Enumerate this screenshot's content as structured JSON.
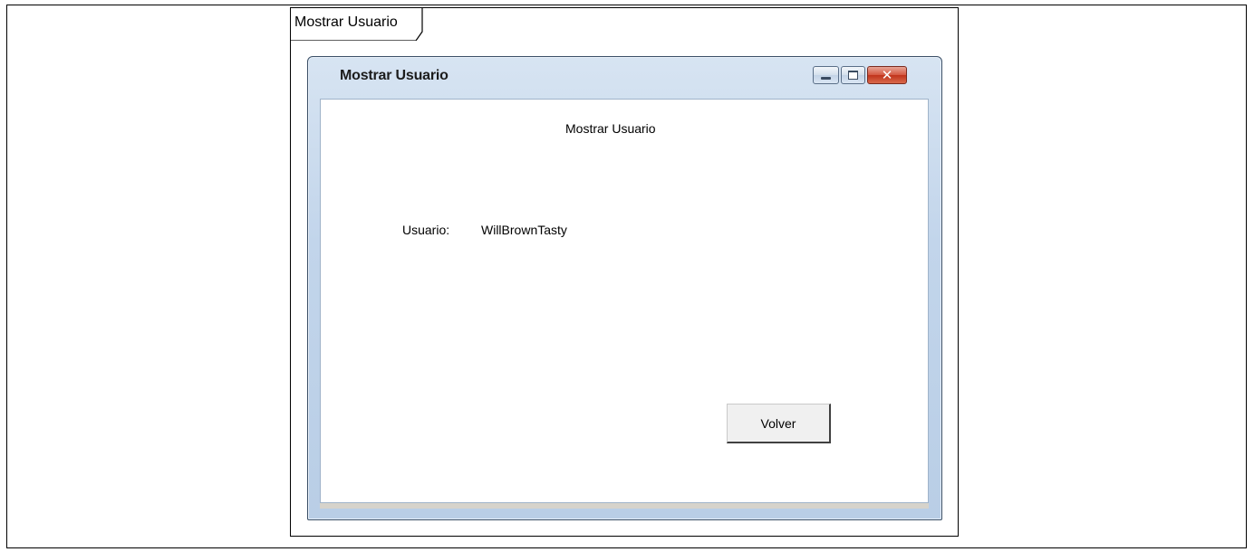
{
  "frame": {
    "tab_label": "Mostrar Usuario"
  },
  "window": {
    "title": "Mostrar Usuario"
  },
  "content": {
    "heading": "Mostrar Usuario",
    "user_label": "Usuario:",
    "user_value": "WillBrownTasty",
    "back_button": "Volver"
  },
  "icons": {
    "minimize": "minimize-icon",
    "maximize": "maximize-icon",
    "close": "close-icon"
  },
  "colors": {
    "titlebar": "#c2d5eb",
    "close_button": "#c0331b"
  }
}
